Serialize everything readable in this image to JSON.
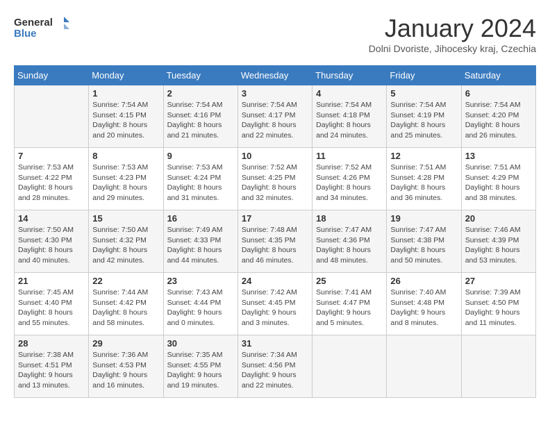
{
  "header": {
    "logo_line1": "General",
    "logo_line2": "Blue",
    "month_title": "January 2024",
    "subtitle": "Dolni Dvoriste, Jihocesky kraj, Czechia"
  },
  "weekdays": [
    "Sunday",
    "Monday",
    "Tuesday",
    "Wednesday",
    "Thursday",
    "Friday",
    "Saturday"
  ],
  "weeks": [
    [
      {
        "day": "",
        "sunrise": "",
        "sunset": "",
        "daylight": ""
      },
      {
        "day": "1",
        "sunrise": "7:54 AM",
        "sunset": "4:15 PM",
        "daylight": "8 hours and 20 minutes."
      },
      {
        "day": "2",
        "sunrise": "7:54 AM",
        "sunset": "4:16 PM",
        "daylight": "8 hours and 21 minutes."
      },
      {
        "day": "3",
        "sunrise": "7:54 AM",
        "sunset": "4:17 PM",
        "daylight": "8 hours and 22 minutes."
      },
      {
        "day": "4",
        "sunrise": "7:54 AM",
        "sunset": "4:18 PM",
        "daylight": "8 hours and 24 minutes."
      },
      {
        "day": "5",
        "sunrise": "7:54 AM",
        "sunset": "4:19 PM",
        "daylight": "8 hours and 25 minutes."
      },
      {
        "day": "6",
        "sunrise": "7:54 AM",
        "sunset": "4:20 PM",
        "daylight": "8 hours and 26 minutes."
      }
    ],
    [
      {
        "day": "7",
        "sunrise": "7:53 AM",
        "sunset": "4:22 PM",
        "daylight": "8 hours and 28 minutes."
      },
      {
        "day": "8",
        "sunrise": "7:53 AM",
        "sunset": "4:23 PM",
        "daylight": "8 hours and 29 minutes."
      },
      {
        "day": "9",
        "sunrise": "7:53 AM",
        "sunset": "4:24 PM",
        "daylight": "8 hours and 31 minutes."
      },
      {
        "day": "10",
        "sunrise": "7:52 AM",
        "sunset": "4:25 PM",
        "daylight": "8 hours and 32 minutes."
      },
      {
        "day": "11",
        "sunrise": "7:52 AM",
        "sunset": "4:26 PM",
        "daylight": "8 hours and 34 minutes."
      },
      {
        "day": "12",
        "sunrise": "7:51 AM",
        "sunset": "4:28 PM",
        "daylight": "8 hours and 36 minutes."
      },
      {
        "day": "13",
        "sunrise": "7:51 AM",
        "sunset": "4:29 PM",
        "daylight": "8 hours and 38 minutes."
      }
    ],
    [
      {
        "day": "14",
        "sunrise": "7:50 AM",
        "sunset": "4:30 PM",
        "daylight": "8 hours and 40 minutes."
      },
      {
        "day": "15",
        "sunrise": "7:50 AM",
        "sunset": "4:32 PM",
        "daylight": "8 hours and 42 minutes."
      },
      {
        "day": "16",
        "sunrise": "7:49 AM",
        "sunset": "4:33 PM",
        "daylight": "8 hours and 44 minutes."
      },
      {
        "day": "17",
        "sunrise": "7:48 AM",
        "sunset": "4:35 PM",
        "daylight": "8 hours and 46 minutes."
      },
      {
        "day": "18",
        "sunrise": "7:47 AM",
        "sunset": "4:36 PM",
        "daylight": "8 hours and 48 minutes."
      },
      {
        "day": "19",
        "sunrise": "7:47 AM",
        "sunset": "4:38 PM",
        "daylight": "8 hours and 50 minutes."
      },
      {
        "day": "20",
        "sunrise": "7:46 AM",
        "sunset": "4:39 PM",
        "daylight": "8 hours and 53 minutes."
      }
    ],
    [
      {
        "day": "21",
        "sunrise": "7:45 AM",
        "sunset": "4:40 PM",
        "daylight": "8 hours and 55 minutes."
      },
      {
        "day": "22",
        "sunrise": "7:44 AM",
        "sunset": "4:42 PM",
        "daylight": "8 hours and 58 minutes."
      },
      {
        "day": "23",
        "sunrise": "7:43 AM",
        "sunset": "4:44 PM",
        "daylight": "9 hours and 0 minutes."
      },
      {
        "day": "24",
        "sunrise": "7:42 AM",
        "sunset": "4:45 PM",
        "daylight": "9 hours and 3 minutes."
      },
      {
        "day": "25",
        "sunrise": "7:41 AM",
        "sunset": "4:47 PM",
        "daylight": "9 hours and 5 minutes."
      },
      {
        "day": "26",
        "sunrise": "7:40 AM",
        "sunset": "4:48 PM",
        "daylight": "9 hours and 8 minutes."
      },
      {
        "day": "27",
        "sunrise": "7:39 AM",
        "sunset": "4:50 PM",
        "daylight": "9 hours and 11 minutes."
      }
    ],
    [
      {
        "day": "28",
        "sunrise": "7:38 AM",
        "sunset": "4:51 PM",
        "daylight": "9 hours and 13 minutes."
      },
      {
        "day": "29",
        "sunrise": "7:36 AM",
        "sunset": "4:53 PM",
        "daylight": "9 hours and 16 minutes."
      },
      {
        "day": "30",
        "sunrise": "7:35 AM",
        "sunset": "4:55 PM",
        "daylight": "9 hours and 19 minutes."
      },
      {
        "day": "31",
        "sunrise": "7:34 AM",
        "sunset": "4:56 PM",
        "daylight": "9 hours and 22 minutes."
      },
      {
        "day": "",
        "sunrise": "",
        "sunset": "",
        "daylight": ""
      },
      {
        "day": "",
        "sunrise": "",
        "sunset": "",
        "daylight": ""
      },
      {
        "day": "",
        "sunrise": "",
        "sunset": "",
        "daylight": ""
      }
    ]
  ]
}
